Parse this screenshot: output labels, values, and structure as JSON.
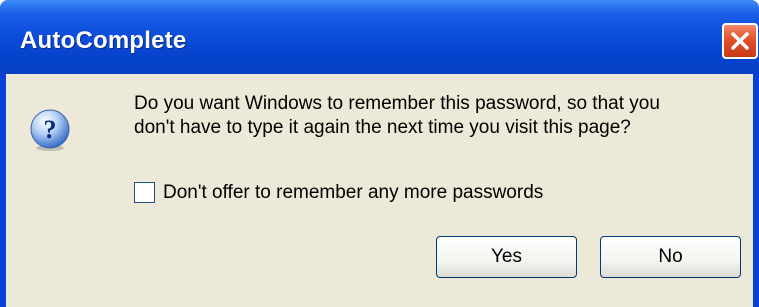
{
  "dialog": {
    "title": "AutoComplete",
    "close_icon": "close-icon",
    "message_line1": "Do you want Windows to remember this password, so that you",
    "message_line2": "don't have to type it again the next time you visit this page?",
    "icon": "question-icon",
    "checkbox_label": "Don't offer to remember any more passwords",
    "checkbox_checked": false,
    "yes_label": "Yes",
    "no_label": "No"
  },
  "colors": {
    "titlebar": "#0a4ad8",
    "client_background": "#ece9d8",
    "close_button": "#e2502c"
  }
}
